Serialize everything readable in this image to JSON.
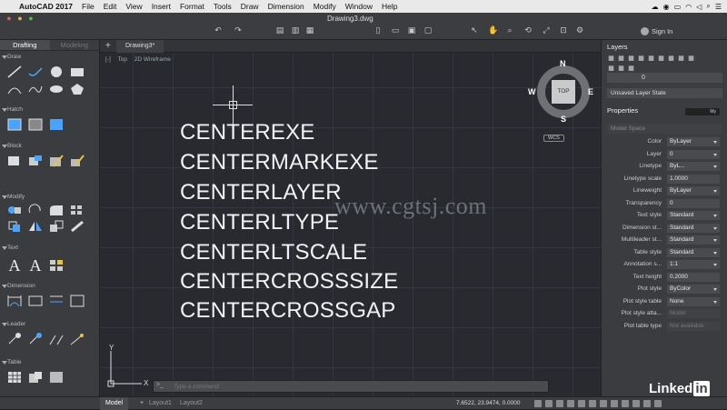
{
  "menubar": {
    "app_name": "AutoCAD 2017",
    "items": [
      "File",
      "Edit",
      "View",
      "Insert",
      "Format",
      "Tools",
      "Draw",
      "Dimension",
      "Modify",
      "Window",
      "Help"
    ]
  },
  "window": {
    "document_title": "Drawing3.dwg",
    "sign_in": "Sign In"
  },
  "sidebar": {
    "tabs": [
      "Drafting",
      "Modeling"
    ],
    "sections": [
      "Draw",
      "Hatch",
      "Block",
      "Modify",
      "Text",
      "Dimension",
      "Leader",
      "Table"
    ]
  },
  "canvas": {
    "doc_tab": "Drawing3*",
    "view_labels": [
      "[-]",
      "Top",
      "2D Wireframe"
    ],
    "text_lines": [
      "CENTEREXE",
      "CENTERMARKEXE",
      "CENTERLAYER",
      "CENTERLTYPE",
      "CENTERLTSCALE",
      "CENTERCROSSSIZE",
      "CENTERCROSSGAP"
    ],
    "watermark": "www.cgtsj.com",
    "viewcube": {
      "top": "TOP",
      "n": "N",
      "s": "S",
      "e": "E",
      "w": "W",
      "wcs": "WCS"
    },
    "ucs": {
      "x": "X",
      "y": "Y"
    }
  },
  "command_line": {
    "prompt": ">_",
    "placeholder": "Type a command"
  },
  "layers": {
    "title": "Layers",
    "current_layer": "0",
    "layer_state": "Unsaved Layer State"
  },
  "properties": {
    "title": "Properties",
    "toggle_label": "My",
    "space": "Model Space",
    "rows": [
      {
        "k": "Color",
        "v": "ByLayer"
      },
      {
        "k": "Layer",
        "v": "0"
      },
      {
        "k": "Linetype",
        "v": "ByL..."
      },
      {
        "k": "Linetype scale",
        "v": "1.0000"
      },
      {
        "k": "Lineweight",
        "v": "ByLayer"
      },
      {
        "k": "Transparency",
        "v": "0"
      },
      {
        "k": "Text style",
        "v": "Standard"
      },
      {
        "k": "Dimension st...",
        "v": "Standard"
      },
      {
        "k": "Multileader st...",
        "v": "Standard"
      },
      {
        "k": "Table style",
        "v": "Standard"
      },
      {
        "k": "Annotation s...",
        "v": "1:1"
      },
      {
        "k": "Text height",
        "v": "0.2000"
      },
      {
        "k": "Plot style",
        "v": "ByColor"
      },
      {
        "k": "Plot style table",
        "v": "None"
      },
      {
        "k": "Plot style atta...",
        "v": "Model"
      },
      {
        "k": "Plot table type",
        "v": "Not available"
      }
    ]
  },
  "status": {
    "tabs": [
      "Model",
      "Layout1",
      "Layout2"
    ],
    "coords": "7.6522, 23.9474, 0.0000"
  },
  "brand": {
    "text": "Linked",
    "in": "in"
  }
}
